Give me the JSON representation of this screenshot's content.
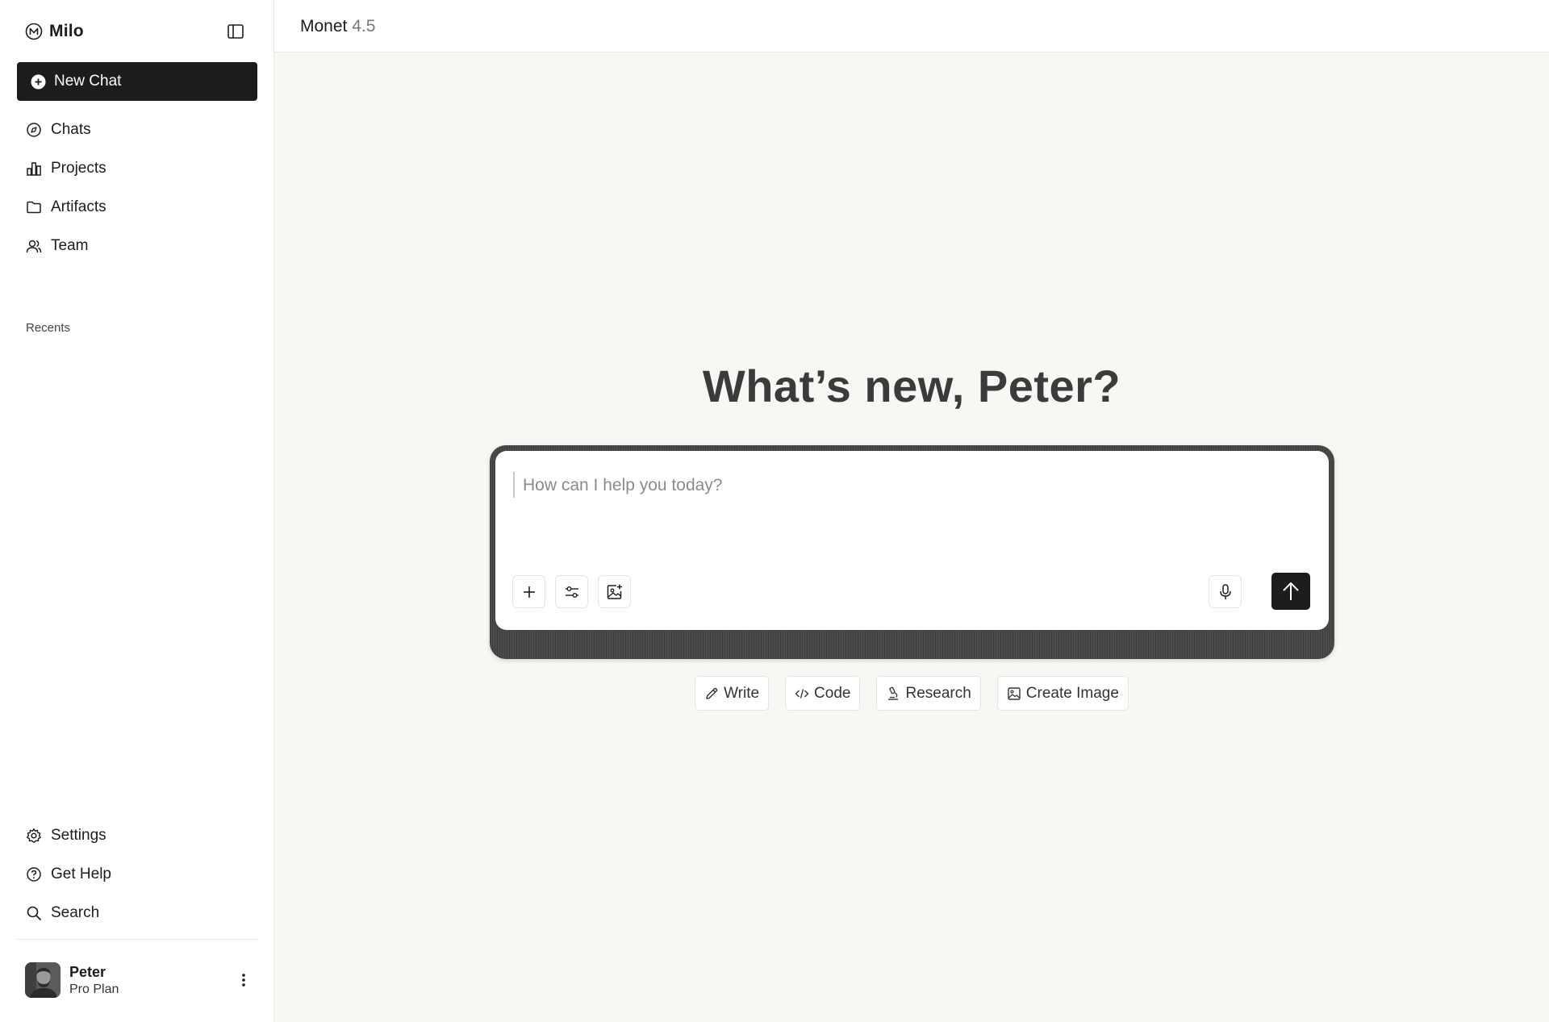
{
  "app": {
    "name": "Milo"
  },
  "sidebar": {
    "new_chat_label": "New Chat",
    "nav": [
      {
        "label": "Chats",
        "icon": "chats-icon"
      },
      {
        "label": "Projects",
        "icon": "projects-icon"
      },
      {
        "label": "Artifacts",
        "icon": "folder-icon"
      },
      {
        "label": "Team",
        "icon": "team-icon"
      }
    ],
    "recents_label": "Recents",
    "bottom_nav": [
      {
        "label": "Settings",
        "icon": "gear-icon"
      },
      {
        "label": "Get Help",
        "icon": "help-icon"
      },
      {
        "label": "Search",
        "icon": "search-icon"
      }
    ],
    "user": {
      "name": "Peter",
      "plan": "Pro Plan"
    }
  },
  "header": {
    "model_name": "Monet",
    "model_version": "4.5"
  },
  "main": {
    "greeting": "What’s new, Peter?",
    "composer": {
      "placeholder": "How can I help you today?",
      "tools": [
        "plus-icon",
        "sliders-icon",
        "image-add-icon"
      ],
      "voice_icon": "microphone-icon",
      "send_icon": "arrow-up-icon"
    },
    "chips": [
      {
        "label": "Write",
        "icon": "pencil-icon"
      },
      {
        "label": "Code",
        "icon": "code-icon"
      },
      {
        "label": "Research",
        "icon": "microscope-icon"
      },
      {
        "label": "Create Image",
        "icon": "image-icon"
      }
    ]
  },
  "colors": {
    "accent": "#1c1c1c",
    "background": "#f8f7f4",
    "sidebar": "#ffffff",
    "composer_frame": "#4b4b4b"
  }
}
